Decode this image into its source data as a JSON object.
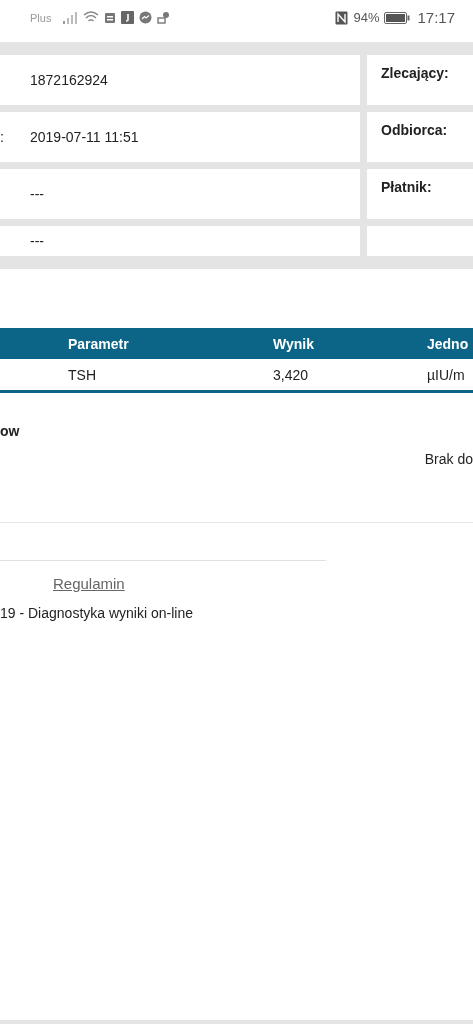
{
  "status_bar": {
    "carrier": "Plus",
    "battery": "94%",
    "time": "17:17"
  },
  "info_rows": [
    {
      "label": "",
      "value": "1872162924",
      "right_label": "Zlecający:"
    },
    {
      "label": ":",
      "value": "2019-07-11 11:51",
      "right_label": "Odbiorca:"
    },
    {
      "label": "",
      "value": "---",
      "right_label": "Płatnik:"
    },
    {
      "label": "",
      "value": "---",
      "right_label": ""
    }
  ],
  "results_table": {
    "columns": [
      "Parametr",
      "Wynik",
      "Jedno"
    ],
    "rows": [
      [
        "TSH",
        "3,420",
        "µIU/m"
      ]
    ]
  },
  "section_heading": "ow",
  "note": "Brak do",
  "footer": {
    "link": "Regulamin",
    "copyright": "19 - Diagnostyka wyniki on-line"
  }
}
